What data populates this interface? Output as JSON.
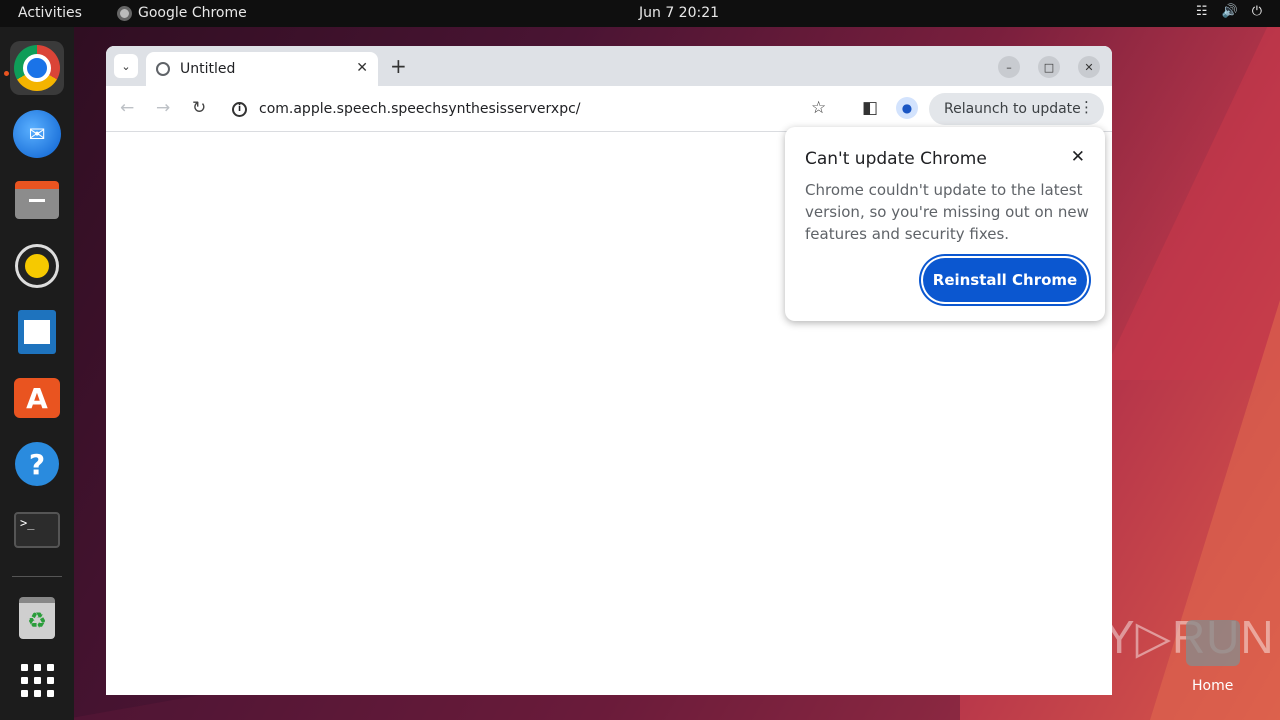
{
  "topbar": {
    "activities": "Activities",
    "app_name": "Google Chrome",
    "clock": "Jun 7  20:21"
  },
  "dock": {
    "items": [
      "chrome",
      "thunderbird",
      "files",
      "rhythmbox",
      "writer",
      "app-center",
      "help",
      "terminal",
      "trash",
      "show-apps"
    ]
  },
  "browser": {
    "tab_title": "Untitled",
    "url": "com.apple.speech.speechsynthesisserverxpc/",
    "relaunch_label": "Relaunch to update"
  },
  "popup": {
    "title": "Can't update Chrome",
    "body": "Chrome couldn't update to the latest version, so you're missing out on new features and security fixes.",
    "button": "Reinstall Chrome"
  },
  "desktop": {
    "watermark": "ANY▷RUN",
    "home_label": "Home"
  },
  "colors": {
    "accent": "#0b57d0",
    "ubuntu_orange": "#e95420"
  }
}
